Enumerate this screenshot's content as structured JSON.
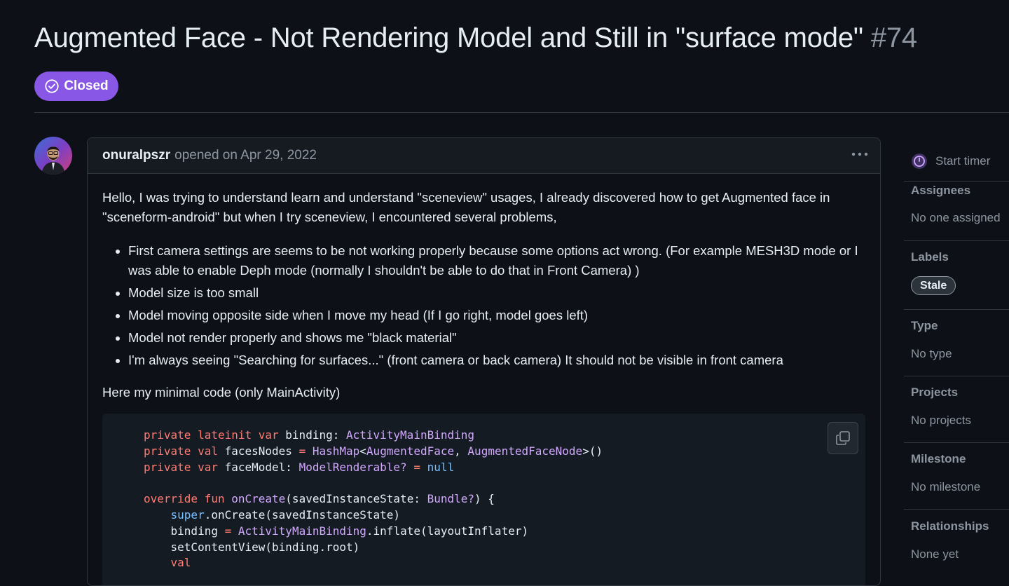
{
  "issue": {
    "title": "Augmented Face - Not Rendering Model and Still in \"surface mode\"",
    "number": "#74",
    "state": "Closed"
  },
  "comment": {
    "author": "onuralpszr",
    "opened_text": "opened on Apr 29, 2022",
    "intro": "Hello, I was trying to understand learn and understand \"sceneview\" usages, I already discovered how to get Augmented face in \"sceneform-android\" but when I try sceneview, I encountered several problems,",
    "bullets": [
      "First camera settings are seems to be not working properly because some options act wrong. (For example MESH3D mode or I was able to enable Deph mode (normally I shouldn't be able to do that in Front Camera) )",
      "Model size is too small",
      "Model moving opposite side when I move my head (If I go right, model goes left)",
      "Model not render properly and shows me \"black material\"",
      "I'm always seeing \"Searching for surfaces...\" (front camera or back camera) It should not be visible in front camera"
    ],
    "code_intro": "Here my minimal code (only MainActivity)"
  },
  "sidebar": {
    "timer_label": "Start timer",
    "assignees": {
      "heading": "Assignees",
      "value": "No one assigned"
    },
    "labels": {
      "heading": "Labels",
      "items": [
        "Stale"
      ]
    },
    "type": {
      "heading": "Type",
      "value": "No type"
    },
    "projects": {
      "heading": "Projects",
      "value": "No projects"
    },
    "milestone": {
      "heading": "Milestone",
      "value": "No milestone"
    },
    "relationships": {
      "heading": "Relationships",
      "value": "None yet"
    }
  },
  "colors": {
    "closed_badge": "#8957e5",
    "background": "#0d1117",
    "muted_text": "#8d96a0",
    "keyword": "#ff7b72",
    "type": "#d2a8ff",
    "constant": "#79c0ff"
  },
  "icons": {
    "state": "check-circle-icon",
    "menu": "kebab-horizontal-icon",
    "copy": "copy-icon",
    "timer": "timer-icon"
  }
}
